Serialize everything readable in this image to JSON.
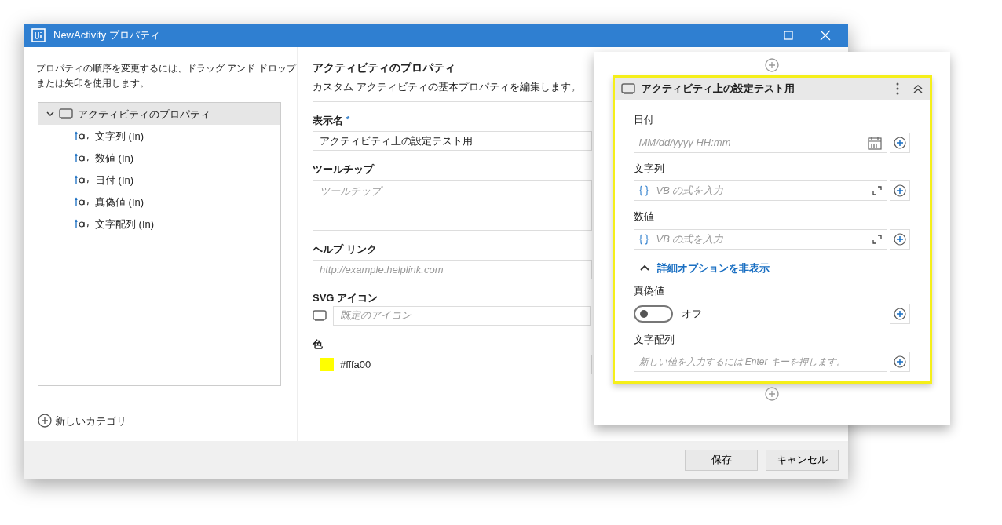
{
  "window": {
    "title": "NewActivity プロパティ"
  },
  "sidebar": {
    "hint": "プロパティの順序を変更するには、ドラッグ アンド ドロップまたは矢印を使用します。",
    "tree": {
      "label": "アクティビティのプロパティ",
      "expanded": true,
      "selected": true,
      "children": [
        {
          "label": "文字列 (In)",
          "selected": false
        },
        {
          "label": "数値 (In)",
          "selected": false
        },
        {
          "label": "日付 (In)",
          "selected": false
        },
        {
          "label": "真偽値 (In)",
          "selected": false
        },
        {
          "label": "文字配列 (In)",
          "selected": false
        }
      ]
    },
    "new_category": "新しいカテゴリ"
  },
  "properties": {
    "heading": "アクティビティのプロパティ",
    "description": "カスタム アクティビティの基本プロパティを編集します。",
    "fields": [
      {
        "kind": "text",
        "label": "表示名",
        "required_mark": "*",
        "value": "アクティビティ上の設定テスト用"
      },
      {
        "kind": "textarea",
        "label": "ツールチップ",
        "placeholder": "ツールチップ"
      },
      {
        "kind": "text",
        "label": "ヘルプ リンク",
        "placeholder": "http://example.helplink.com"
      },
      {
        "kind": "icon",
        "label": "SVG アイコン",
        "placeholder": "既定のアイコン"
      },
      {
        "kind": "color",
        "label": "色",
        "value": "#fffa00",
        "color": "#ffff00"
      }
    ]
  },
  "buttons": [
    {
      "label": "保存"
    },
    {
      "label": "キャンセル"
    }
  ],
  "preview": {
    "title": "アクティビティ上の設定テスト用",
    "items": [
      {
        "kind": "date",
        "label": "日付",
        "placeholder": "MM/dd/yyyy HH:mm"
      },
      {
        "kind": "expression",
        "label": "文字列",
        "placeholder": "VB の式を入力"
      },
      {
        "kind": "expression",
        "label": "数値",
        "placeholder": "VB の式を入力"
      },
      {
        "kind": "advanced",
        "label": "詳細オプションを非表示",
        "expanded": true
      },
      {
        "kind": "switch",
        "label": "真偽値",
        "on": false,
        "state_text": "オフ"
      },
      {
        "kind": "list",
        "label": "文字配列",
        "placeholder": "新しい値を入力するには Enter キーを押します。"
      }
    ]
  }
}
